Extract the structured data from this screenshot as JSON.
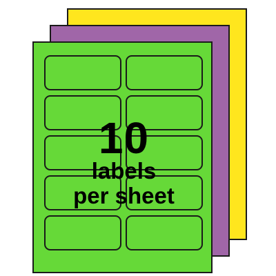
{
  "product": {
    "count_text": "10",
    "caption_line1": "labels",
    "caption_line2": "per sheet"
  },
  "colors": {
    "back_sheet": "#ffe61e",
    "middle_sheet": "#a066a8",
    "front_sheet": "#66d938",
    "outline": "#1a1a1a"
  },
  "labels": {
    "rows": 5,
    "columns": 2
  }
}
